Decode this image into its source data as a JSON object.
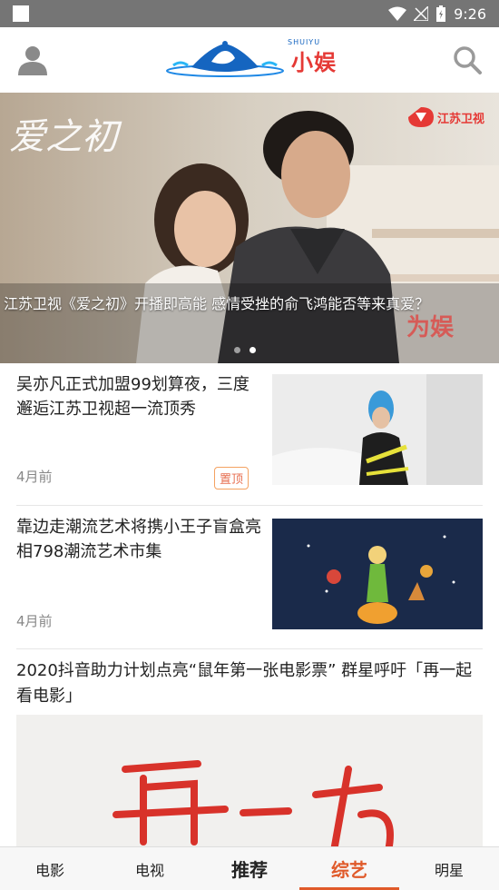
{
  "status_bar": {
    "time": "9:26"
  },
  "header": {
    "logo_text": "小娱",
    "logo_sub": "SHUIYU",
    "icons": [
      "user-icon",
      "search-icon"
    ]
  },
  "banner": {
    "title_art": "爱之初",
    "channel": "江苏卫视",
    "watermark": "为娱",
    "caption": "江苏卫视《爱之初》开播即高能 感情受挫的俞飞鸿能否等来真爱？",
    "dots": 2,
    "active_dot": 2
  },
  "news": [
    {
      "title": "吴亦凡正式加盟99划算夜，三度邂逅江苏卫视超一流顶秀",
      "time": "4月前",
      "badge": "置顶"
    },
    {
      "title": "靠边走潮流艺术将携小王子盲盒亮相798潮流艺术市集",
      "time": "4月前"
    },
    {
      "title": "2020抖音助力计划点亮“鼠年第一张电影票” 群星呼吁「再一起看电影」"
    }
  ],
  "tabs": [
    {
      "label": "电影"
    },
    {
      "label": "电视"
    },
    {
      "label": "推荐"
    },
    {
      "label": "综艺"
    },
    {
      "label": "明星"
    }
  ],
  "colors": {
    "accent": "#e05a2a",
    "brand_red": "#e53935",
    "brand_blue": "#1565c0"
  }
}
